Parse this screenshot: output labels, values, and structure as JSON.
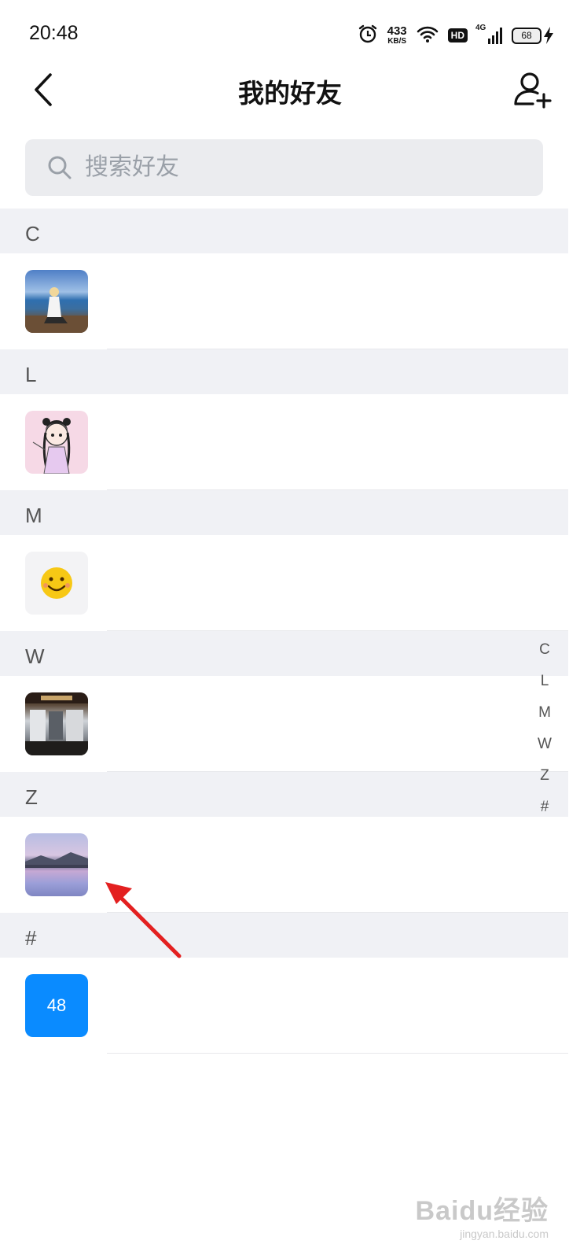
{
  "status_bar": {
    "time": "20:48",
    "net_speed_value": "433",
    "net_speed_unit": "KB/S",
    "hd": "HD",
    "network": "4G",
    "battery": "68",
    "icons": [
      "alarm-icon",
      "wifi-icon",
      "hd-icon",
      "cell-signal-icon",
      "battery-icon",
      "charging-icon"
    ]
  },
  "header": {
    "title": "我的好友",
    "back_icon": "chevron-left-icon",
    "add_icon": "add-friend-icon"
  },
  "search": {
    "placeholder": "搜索好友",
    "value": ""
  },
  "sections": [
    {
      "letter": "C",
      "avatar": "photo-person-lakeside"
    },
    {
      "letter": "L",
      "avatar": "anime-girl-illustration"
    },
    {
      "letter": "M",
      "avatar": "smiley-emoji"
    },
    {
      "letter": "W",
      "avatar": "photo-shop-storefront"
    },
    {
      "letter": "Z",
      "avatar": "photo-lake-sunset"
    },
    {
      "letter": "#",
      "avatar_text": "48",
      "avatar_color": "#0a8bff"
    }
  ],
  "alphabet_index": [
    "C",
    "L",
    "M",
    "W",
    "Z",
    "#"
  ],
  "annotation": {
    "color": "#e32020",
    "points_to": "Z section friend avatar"
  },
  "watermark": {
    "brand": "Baidu经验",
    "url": "jingyan.baidu.com"
  }
}
